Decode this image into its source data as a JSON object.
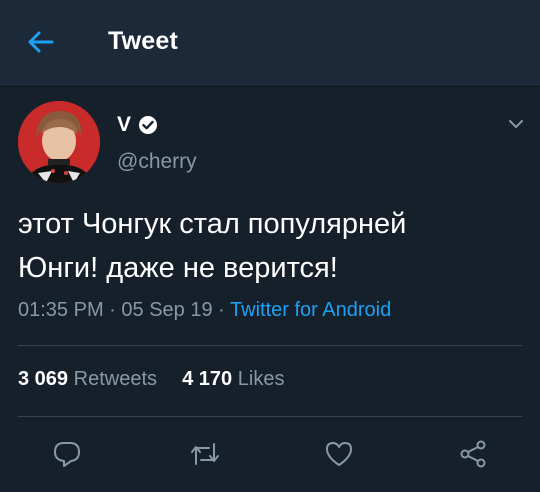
{
  "header": {
    "title": "Tweet"
  },
  "tweet": {
    "author_name": "V",
    "handle": "@cherry",
    "text_line1": "этот Чонгук стал популярней",
    "text_line2": "Юнги! даже не верится!",
    "time": "01:35 PM",
    "date": "05 Sep 19",
    "source": "Twitter for Android"
  },
  "stats": {
    "retweets_count": "3 069",
    "retweets_label": "Retweets",
    "likes_count": "4 170",
    "likes_label": "Likes"
  },
  "colors": {
    "background": "#15202b",
    "header_bg": "#1c2938",
    "accent": "#1da1f2",
    "secondary_text": "#8899a6",
    "divider": "#38444d"
  },
  "icons": {
    "back": "arrow-left-icon",
    "verified": "verified-badge-icon",
    "caret": "chevron-down-icon",
    "reply": "reply-icon",
    "retweet": "retweet-icon",
    "like": "heart-icon",
    "share": "share-icon"
  }
}
